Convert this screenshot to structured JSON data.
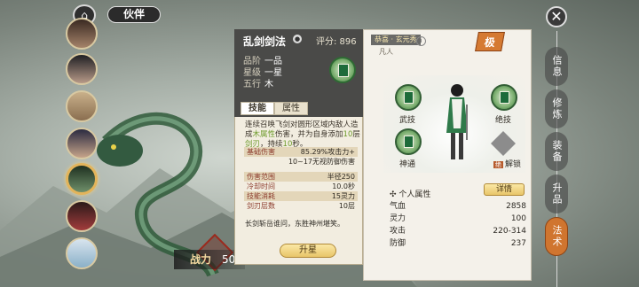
{
  "top": {
    "title": "伙伴"
  },
  "power": {
    "label": "战力",
    "value": "50"
  },
  "skill": {
    "name": "乱剑剑法",
    "score": "评分: 896",
    "meta": [
      {
        "k": "品阶",
        "v": "一品"
      },
      {
        "k": "星级",
        "v": "一星"
      },
      {
        "k": "五行",
        "v": "木"
      }
    ],
    "tabs": [
      "技能",
      "属性"
    ],
    "desc_parts": [
      "连续召唤飞剑对圆形区域内敌人造成",
      "木属性",
      "伤害，并为自身添加",
      "10",
      "层",
      "剑刃",
      "，持续",
      "10",
      "秒。"
    ],
    "stats": [
      {
        "k": "基础伤害",
        "v": "85.29%攻击力+"
      },
      {
        "k": "",
        "v": "10~17无视防御伤害"
      },
      {
        "k": "伤害范围",
        "v": "半径250"
      },
      {
        "k": "冷却时间",
        "v": "10.0秒"
      },
      {
        "k": "技能消耗",
        "v": "15灵力"
      },
      {
        "k": "剑刃层数",
        "v": "10层"
      }
    ],
    "poem": "长剑斩岳谁问，东胜神州堪笑。",
    "upgrade_label": "升星"
  },
  "panel": {
    "name_tag": "恭喜 · 玄元秀",
    "realm": "凡人",
    "rank": "极",
    "slots": [
      "武技",
      "绝技",
      "神通"
    ],
    "lock_tag": "绝",
    "lock_label": "解锁",
    "attr_header": "个人属性",
    "detail_label": "详情",
    "attrs": [
      {
        "k": "气血",
        "v": "2858"
      },
      {
        "k": "灵力",
        "v": "100"
      },
      {
        "k": "攻击",
        "v": "220-314"
      },
      {
        "k": "防御",
        "v": "237"
      }
    ]
  },
  "menu": [
    "信息",
    "修炼",
    "装备",
    "升品",
    "法术"
  ],
  "colors": {
    "accent": "#d0752f",
    "skill_green": "#7db071",
    "panel_bg": "#f4f1ea"
  }
}
